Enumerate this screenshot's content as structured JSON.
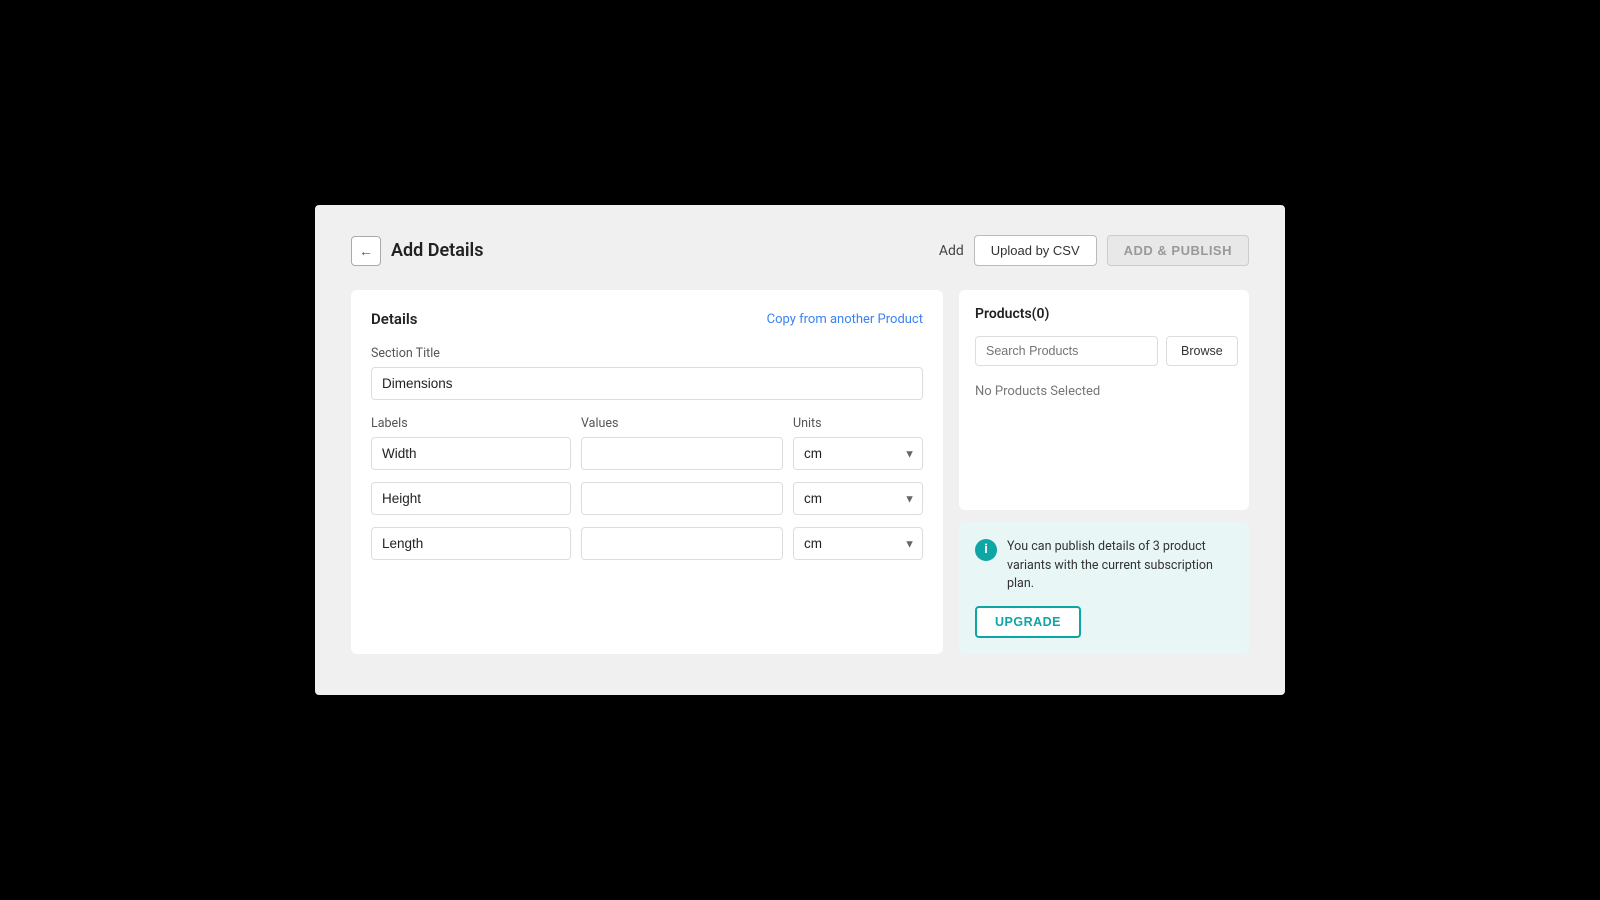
{
  "header": {
    "back_label": "←",
    "title": "Add Details",
    "add_label": "Add",
    "upload_csv_label": "Upload by CSV",
    "add_publish_label": "ADD & PUBLISH"
  },
  "left_panel": {
    "panel_title": "Details",
    "copy_link_label": "Copy from another Product",
    "section_title_label": "Section Title",
    "section_title_value": "Dimensions",
    "rows": [
      {
        "labels_header": "Labels",
        "values_header": "Values",
        "units_header": "Units",
        "label_value": "Width",
        "value_value": "",
        "unit_value": "cm"
      },
      {
        "label_value": "Height",
        "value_value": "",
        "unit_value": "cm"
      },
      {
        "label_value": "Length",
        "value_value": "",
        "unit_value": "cm"
      }
    ]
  },
  "right_panel": {
    "products_title": "Products(0)",
    "search_placeholder": "Search Products",
    "browse_label": "Browse",
    "no_products_label": "No Products Selected",
    "info_text": "You can publish details of 3 product variants with the current subscription plan.",
    "upgrade_label": "UPGRADE"
  }
}
